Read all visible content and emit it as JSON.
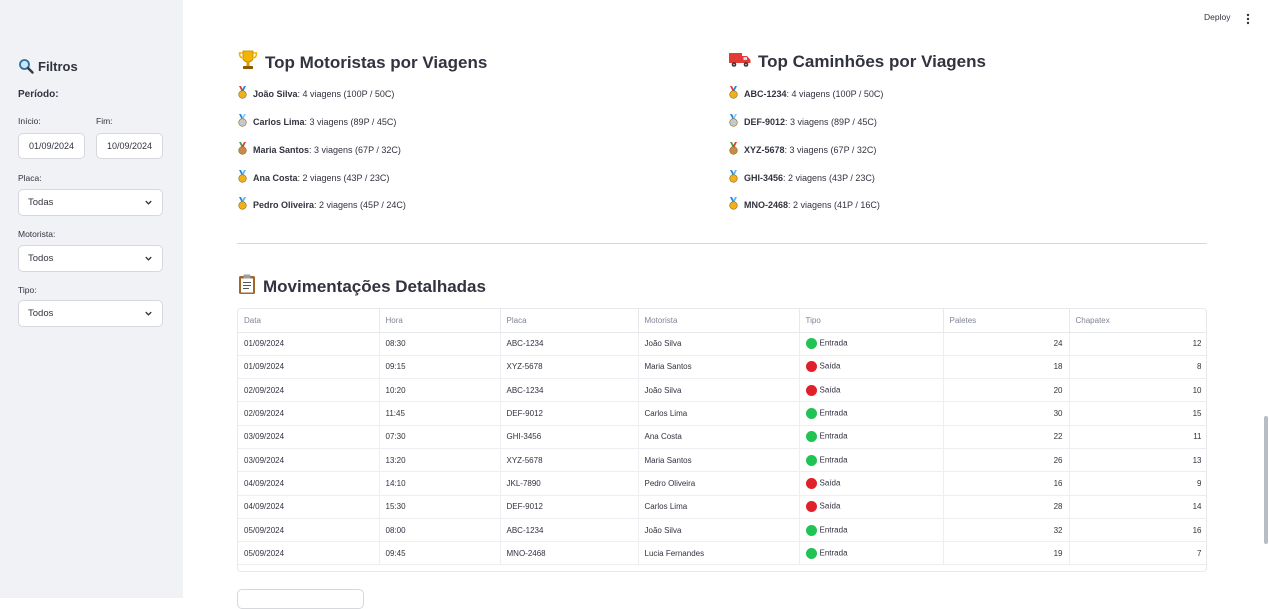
{
  "header": {
    "deploy_label": "Deploy"
  },
  "sidebar": {
    "title": "Filtros",
    "periodo_label": "Período:",
    "inicio_label": "Início:",
    "fim_label": "Fim:",
    "inicio_value": "01/09/2024",
    "fim_value": "10/09/2024",
    "placa_label": "Placa:",
    "placa_value": "Todas",
    "motorista_label": "Motorista:",
    "motorista_value": "Todos",
    "tipo_label": "Tipo:",
    "tipo_value": "Todos"
  },
  "top_motoristas": {
    "title": "Top Motoristas por Viagens",
    "items": [
      {
        "name": "João Silva",
        "detail": ": 4 viagens (100P / 50C)",
        "medal": "gold"
      },
      {
        "name": "Carlos Lima",
        "detail": ": 3 viagens (89P / 45C)",
        "medal": "silver"
      },
      {
        "name": "Maria Santos",
        "detail": ": 3 viagens (67P / 32C)",
        "medal": "bronze"
      },
      {
        "name": "Ana Costa",
        "detail": ": 2 viagens (43P / 23C)",
        "medal": "sports"
      },
      {
        "name": "Pedro Oliveira",
        "detail": ": 2 viagens (45P / 24C)",
        "medal": "sports"
      }
    ]
  },
  "top_caminhoes": {
    "title": "Top Caminhões por Viagens",
    "items": [
      {
        "name": "ABC-1234",
        "detail": ": 4 viagens (100P / 50C)",
        "medal": "gold"
      },
      {
        "name": "DEF-9012",
        "detail": ": 3 viagens (89P / 45C)",
        "medal": "silver"
      },
      {
        "name": "XYZ-5678",
        "detail": ": 3 viagens (67P / 32C)",
        "medal": "bronze"
      },
      {
        "name": "GHI-3456",
        "detail": ": 2 viagens (43P / 23C)",
        "medal": "sports"
      },
      {
        "name": "MNO-2468",
        "detail": ": 2 viagens (41P / 16C)",
        "medal": "sports"
      }
    ]
  },
  "movimentacoes": {
    "title": "Movimentações Detalhadas",
    "columns": [
      "Data",
      "Hora",
      "Placa",
      "Motorista",
      "Tipo",
      "Paletes",
      "Chapatex"
    ],
    "rows": [
      [
        "01/09/2024",
        "08:30",
        "ABC-1234",
        "João Silva",
        "Entrada",
        "24",
        "12"
      ],
      [
        "01/09/2024",
        "09:15",
        "XYZ-5678",
        "Maria Santos",
        "Saída",
        "18",
        "8"
      ],
      [
        "02/09/2024",
        "10:20",
        "ABC-1234",
        "João Silva",
        "Saída",
        "20",
        "10"
      ],
      [
        "02/09/2024",
        "11:45",
        "DEF-9012",
        "Carlos Lima",
        "Entrada",
        "30",
        "15"
      ],
      [
        "03/09/2024",
        "07:30",
        "GHI-3456",
        "Ana Costa",
        "Entrada",
        "22",
        "11"
      ],
      [
        "03/09/2024",
        "13:20",
        "XYZ-5678",
        "Maria Santos",
        "Entrada",
        "26",
        "13"
      ],
      [
        "04/09/2024",
        "14:10",
        "JKL-7890",
        "Pedro Oliveira",
        "Saída",
        "16",
        "9"
      ],
      [
        "04/09/2024",
        "15:30",
        "DEF-9012",
        "Carlos Lima",
        "Saída",
        "28",
        "14"
      ],
      [
        "05/09/2024",
        "08:00",
        "ABC-1234",
        "João Silva",
        "Entrada",
        "32",
        "16"
      ],
      [
        "05/09/2024",
        "09:45",
        "MNO-2468",
        "Lucia Fernandes",
        "Entrada",
        "19",
        "7"
      ]
    ]
  },
  "chart_data": {
    "type": "table",
    "columns": [
      "Data",
      "Hora",
      "Placa",
      "Motorista",
      "Tipo",
      "Paletes",
      "Chapatex"
    ],
    "rows": [
      [
        "01/09/2024",
        "08:30",
        "ABC-1234",
        "João Silva",
        "Entrada",
        24,
        12
      ],
      [
        "01/09/2024",
        "09:15",
        "XYZ-5678",
        "Maria Santos",
        "Saída",
        18,
        8
      ],
      [
        "02/09/2024",
        "10:20",
        "ABC-1234",
        "João Silva",
        "Saída",
        20,
        10
      ],
      [
        "02/09/2024",
        "11:45",
        "DEF-9012",
        "Carlos Lima",
        "Entrada",
        30,
        15
      ],
      [
        "03/09/2024",
        "07:30",
        "GHI-3456",
        "Ana Costa",
        "Entrada",
        22,
        11
      ],
      [
        "03/09/2024",
        "13:20",
        "XYZ-5678",
        "Maria Santos",
        "Entrada",
        26,
        13
      ],
      [
        "04/09/2024",
        "14:10",
        "JKL-7890",
        "Pedro Oliveira",
        "Saída",
        16,
        9
      ],
      [
        "04/09/2024",
        "15:30",
        "DEF-9012",
        "Carlos Lima",
        "Saída",
        28,
        14
      ],
      [
        "05/09/2024",
        "08:00",
        "ABC-1234",
        "João Silva",
        "Entrada",
        32,
        16
      ],
      [
        "05/09/2024",
        "09:45",
        "MNO-2468",
        "Lucia Fernandes",
        "Entrada",
        19,
        7
      ]
    ]
  },
  "colors": {
    "sidebar_bg": "#f0f2f6",
    "entrada": "#21c354",
    "saida": "#e0202a"
  }
}
